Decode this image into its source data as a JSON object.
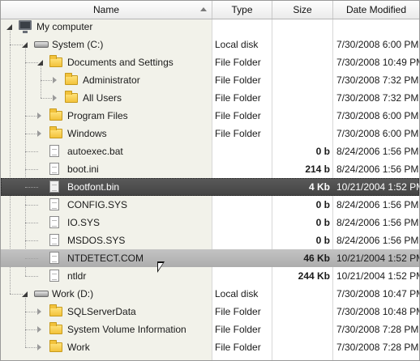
{
  "columns": {
    "name": "Name",
    "type": "Type",
    "size": "Size",
    "date": "Date Modified"
  },
  "rows": [
    {
      "name": "My computer",
      "type": "",
      "size": "",
      "date": "",
      "icon": "computer",
      "level": 0,
      "toggle": "expanded"
    },
    {
      "name": "System (C:)",
      "type": "Local disk",
      "size": "",
      "date": "7/30/2008 6:00 PM",
      "icon": "drive",
      "level": 1,
      "toggle": "expanded"
    },
    {
      "name": "Documents and Settings",
      "type": "File Folder",
      "size": "",
      "date": "7/30/2008 10:49 PM",
      "icon": "folder",
      "level": 2,
      "toggle": "expanded"
    },
    {
      "name": "Administrator",
      "type": "File Folder",
      "size": "",
      "date": "7/30/2008 7:32 PM",
      "icon": "folder",
      "level": 3,
      "toggle": "collapsed"
    },
    {
      "name": "All Users",
      "type": "File Folder",
      "size": "",
      "date": "7/30/2008 7:32 PM",
      "icon": "folder",
      "level": 3,
      "toggle": "collapsed"
    },
    {
      "name": "Program Files",
      "type": "File Folder",
      "size": "",
      "date": "7/30/2008 6:00 PM",
      "icon": "folder",
      "level": 2,
      "toggle": "collapsed"
    },
    {
      "name": "Windows",
      "type": "File Folder",
      "size": "",
      "date": "7/30/2008 6:00 PM",
      "icon": "folder",
      "level": 2,
      "toggle": "collapsed"
    },
    {
      "name": "autoexec.bat",
      "type": "",
      "size": "0 b",
      "date": "8/24/2006 1:56 PM",
      "icon": "file",
      "level": 2,
      "toggle": "none"
    },
    {
      "name": "boot.ini",
      "type": "",
      "size": "214 b",
      "date": "8/24/2006 1:56 PM",
      "icon": "file",
      "level": 2,
      "toggle": "none"
    },
    {
      "name": "Bootfont.bin",
      "type": "",
      "size": "4 Kb",
      "date": "10/21/2004 1:52 PM",
      "icon": "file",
      "level": 2,
      "toggle": "none",
      "state": "selected"
    },
    {
      "name": "CONFIG.SYS",
      "type": "",
      "size": "0 b",
      "date": "8/24/2006 1:56 PM",
      "icon": "file",
      "level": 2,
      "toggle": "none"
    },
    {
      "name": "IO.SYS",
      "type": "",
      "size": "0 b",
      "date": "8/24/2006 1:56 PM",
      "icon": "file",
      "level": 2,
      "toggle": "none"
    },
    {
      "name": "MSDOS.SYS",
      "type": "",
      "size": "0 b",
      "date": "8/24/2006 1:56 PM",
      "icon": "file",
      "level": 2,
      "toggle": "none"
    },
    {
      "name": "NTDETECT.COM",
      "type": "",
      "size": "46 Kb",
      "date": "10/21/2004 1:52 PM",
      "icon": "file",
      "level": 2,
      "toggle": "none",
      "state": "hovered"
    },
    {
      "name": "ntldr",
      "type": "",
      "size": "244 Kb",
      "date": "10/21/2004 1:52 PM",
      "icon": "file",
      "level": 2,
      "toggle": "none"
    },
    {
      "name": "Work (D:)",
      "type": "Local disk",
      "size": "",
      "date": "7/30/2008 10:47 PM",
      "icon": "drive",
      "level": 1,
      "toggle": "expanded"
    },
    {
      "name": "SQLServerData",
      "type": "File Folder",
      "size": "",
      "date": "7/30/2008 10:48 PM",
      "icon": "folder",
      "level": 2,
      "toggle": "collapsed"
    },
    {
      "name": "System Volume Information",
      "type": "File Folder",
      "size": "",
      "date": "7/30/2008 7:28 PM",
      "icon": "folder",
      "level": 2,
      "toggle": "collapsed"
    },
    {
      "name": "Work",
      "type": "File Folder",
      "size": "",
      "date": "7/30/2008 7:28 PM",
      "icon": "folder",
      "level": 2,
      "toggle": "collapsed"
    }
  ]
}
